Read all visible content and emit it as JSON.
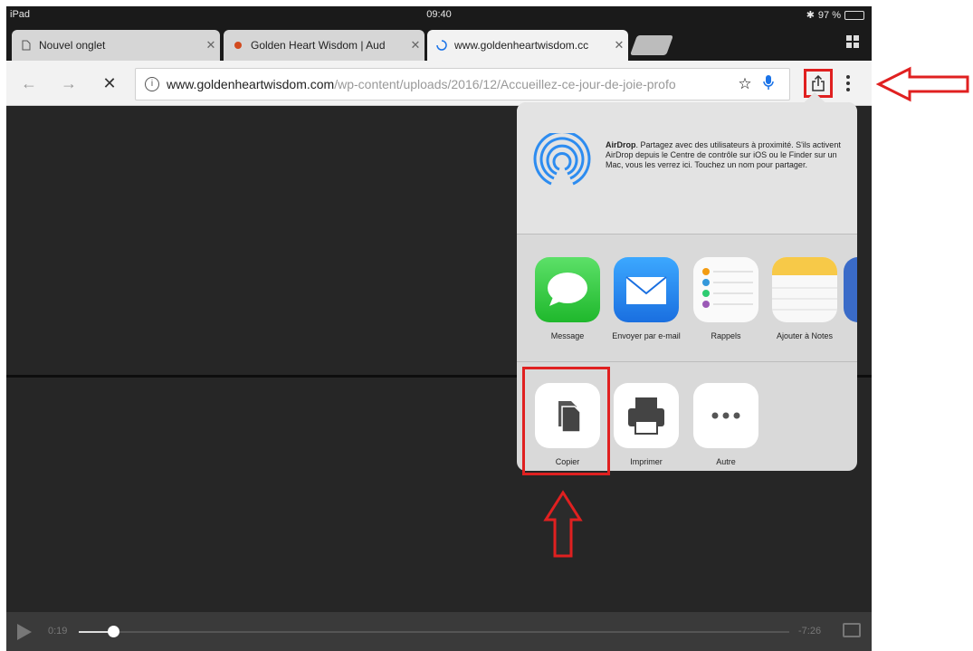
{
  "status_bar": {
    "device": "iPad",
    "time": "09:40",
    "battery": "97 %"
  },
  "tabs": [
    {
      "title": "Nouvel onglet",
      "close": "✕"
    },
    {
      "title": "Golden Heart Wisdom | Aud",
      "close": "✕"
    },
    {
      "title": "www.goldenheartwisdom.cc",
      "close": "✕"
    }
  ],
  "toolbar": {
    "back": "←",
    "forward": "→",
    "stop": "✕",
    "url_host": "www.goldenheartwisdom.com",
    "url_path": "/wp-content/uploads/2016/12/Accueillez-ce-jour-de-joie-profo"
  },
  "share_sheet": {
    "airdrop_title": "AirDrop",
    "airdrop_text": ". Partagez avec des utilisateurs à proximité. S'ils activent AirDrop depuis le Centre de contrôle sur iOS ou le Finder sur un Mac, vous les verrez ici. Touchez un nom pour partager.",
    "apps": [
      {
        "label": "Message"
      },
      {
        "label": "Envoyer par e-mail"
      },
      {
        "label": "Rappels"
      },
      {
        "label": "Ajouter à Notes"
      }
    ],
    "actions": [
      {
        "label": "Copier"
      },
      {
        "label": "Imprimer"
      },
      {
        "label": "Autre"
      }
    ]
  },
  "video": {
    "elapsed": "0:19",
    "remaining": "-7:26",
    "progress": 0.045
  },
  "colors": {
    "highlight": "#e02020",
    "toolbar": "#f2f2f2",
    "sheet": "#d9d9d9"
  }
}
